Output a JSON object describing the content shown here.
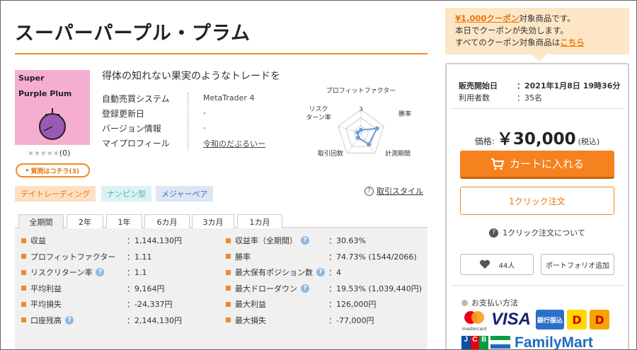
{
  "product": {
    "title": "スーパーパープル・プラム",
    "thumbnail_line1": "Super",
    "thumbnail_line2": "Purple Plum",
    "stars": "★★★★★",
    "review_count": "(0)",
    "question_button": "質問はコチラ(3)",
    "tagline": "得体の知れない果実のようなトレードを"
  },
  "info": {
    "rows": [
      {
        "label": "自動売買システム",
        "value": "MetaTrader 4"
      },
      {
        "label": "登録更新日",
        "value": "-"
      },
      {
        "label": "バージョン情報",
        "value": "-"
      },
      {
        "label": "マイプロフィール",
        "value": "令和のだぶるいー"
      }
    ]
  },
  "radar": {
    "labels": [
      "プロフィットファクター",
      "勝率",
      "計測期間",
      "取引回数",
      "リスク",
      "ターン率"
    ],
    "scale_label": "3",
    "values": [
      0.15,
      0.7,
      0.55,
      0.2,
      0.15
    ],
    "color": "#6a9fd8"
  },
  "tags": [
    {
      "label": "デイトレーディング",
      "bg": "#fde0c2",
      "fg": "#e8760a"
    },
    {
      "label": "ナンピン型",
      "bg": "#daf2f2",
      "fg": "#5aa9b0"
    },
    {
      "label": "メジャーペア",
      "bg": "#dce7f5",
      "fg": "#4a70a8"
    }
  ],
  "trade_style_link": "取引スタイル",
  "tabs": [
    "全期間",
    "2年",
    "1年",
    "6カ月",
    "3カ月",
    "1カ月"
  ],
  "stats": {
    "left": [
      {
        "label": "収益",
        "value": "：1,144,130円",
        "help": false
      },
      {
        "label": "プロフィットファクター",
        "value": "：1.11",
        "help": false
      },
      {
        "label": "リスクリターン率",
        "value": "：1.1",
        "help": true
      },
      {
        "label": "平均利益",
        "value": "：9,164円",
        "help": false
      },
      {
        "label": "平均損失",
        "value": "：-24,337円",
        "help": false
      },
      {
        "label": "口座残高",
        "value": "：2,144,130円",
        "help": true
      }
    ],
    "right": [
      {
        "label": "収益率（全期間）",
        "value": "：30.63%",
        "help": true
      },
      {
        "label": "勝率",
        "value": "：74.73% (1544/2066)",
        "help": false
      },
      {
        "label": "最大保有ポジション数",
        "value": "：4",
        "help": true
      },
      {
        "label": "最大ドローダウン",
        "value": "：19.53% (1,039,440円)",
        "help": true
      },
      {
        "label": "最大利益",
        "value": "：126,000円",
        "help": false
      },
      {
        "label": "最大損失",
        "value": "：-77,000円",
        "help": false
      }
    ]
  },
  "coupon": {
    "amount": "¥1,000クーポン",
    "line1_suffix": "対象商品です。",
    "line2": "本日でクーポンが失効します。",
    "line3_prefix": "すべてのクーポン対象商品は",
    "line3_link": "こちら"
  },
  "purchase": {
    "sale_start_label": "販売開始日",
    "sale_start_value": "：2021年1月8日 19時36分",
    "users_label": "利用者数",
    "users_value": "：35名",
    "price_label": "価格:",
    "price": "￥30,000",
    "tax": "(税込)",
    "cart_button": "カートに入れる",
    "one_click_button": "1クリック注文",
    "about_one_click": "1クリック注文について",
    "favorites_count": "44人",
    "portfolio_button": "ポートフォリオ追加",
    "payment_title": "お支払い方法",
    "payment_methods": [
      "mastercard",
      "VISA",
      "銀行振込",
      "ドン・キホーテ",
      "Daily",
      "JCB",
      "FamilyMart"
    ]
  },
  "colors": {
    "accent": "#f08a24",
    "thumbnail_bg": "#f5aed0",
    "plum": "#9b59b6"
  }
}
